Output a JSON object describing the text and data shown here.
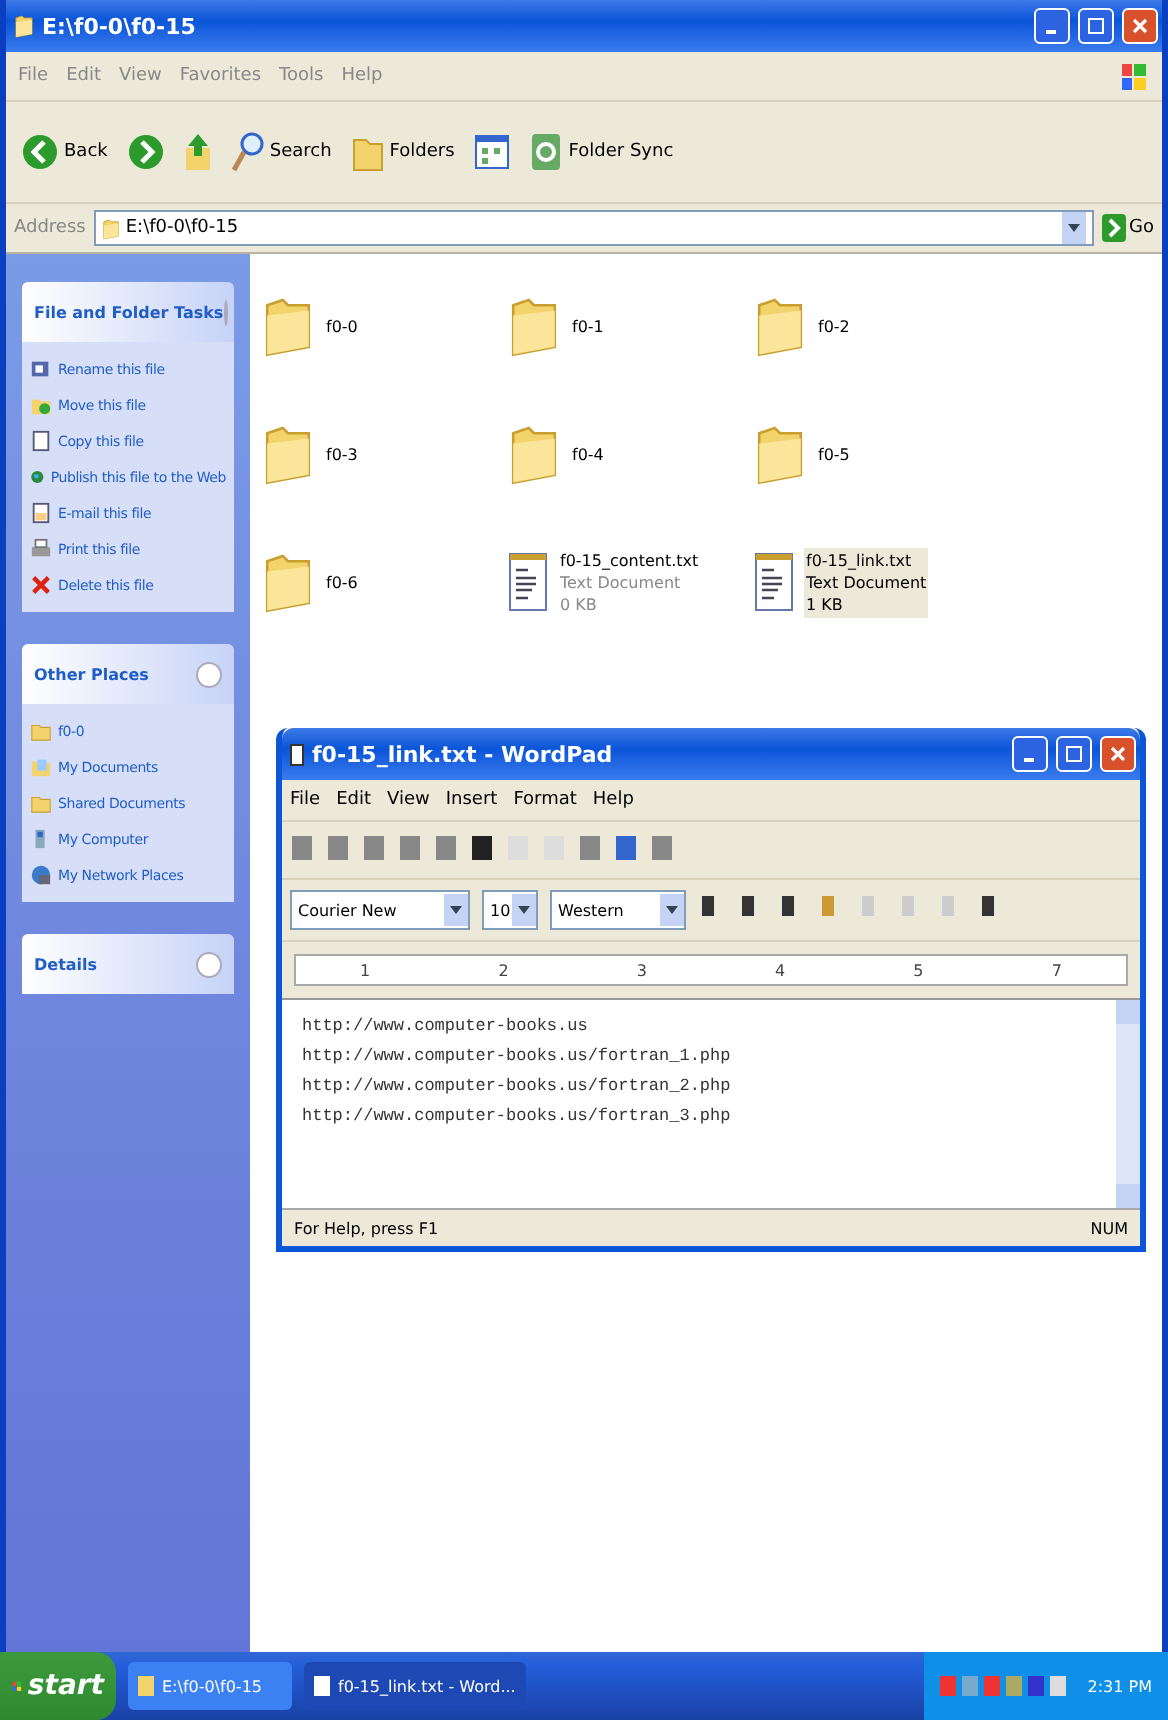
{
  "explorer": {
    "title": "E:\\f0-0\\f0-15",
    "menu": [
      "File",
      "Edit",
      "View",
      "Favorites",
      "Tools",
      "Help"
    ],
    "toolbar": [
      {
        "kind": "back",
        "label": "Back"
      },
      {
        "kind": "forward"
      },
      {
        "kind": "up"
      },
      {
        "kind": "search",
        "label": "Search"
      },
      {
        "kind": "folders",
        "label": "Folders"
      },
      {
        "kind": "views"
      },
      {
        "kind": "sync",
        "label": "Folder Sync"
      }
    ],
    "address": {
      "label": "Address",
      "value": "E:\\f0-0\\f0-15",
      "go": "Go"
    },
    "panels": [
      {
        "title": "File and Folder Tasks",
        "expanded": true,
        "items": [
          {
            "label": "Rename this file"
          },
          {
            "label": "Move this file"
          },
          {
            "label": "Copy this file"
          },
          {
            "label": "Publish this file to the Web"
          },
          {
            "label": "E-mail this file"
          },
          {
            "label": "Print this file"
          },
          {
            "label": "Delete this file"
          }
        ]
      },
      {
        "title": "Other Places",
        "expanded": true,
        "items": [
          {
            "label": "f0-0"
          },
          {
            "label": "My Documents"
          },
          {
            "label": "Shared Documents"
          },
          {
            "label": "My Computer"
          },
          {
            "label": "My Network Places"
          }
        ]
      },
      {
        "title": "Details",
        "expanded": false
      }
    ],
    "files": [
      {
        "kind": "folder",
        "name": "f0-0",
        "selected": false
      },
      {
        "kind": "folder",
        "name": "f0-1",
        "selected": false
      },
      {
        "kind": "folder",
        "name": "f0-2",
        "selected": false
      },
      {
        "kind": "folder",
        "name": "f0-3",
        "selected": false
      },
      {
        "kind": "folder",
        "name": "f0-4",
        "selected": false
      },
      {
        "kind": "folder",
        "name": "f0-5",
        "selected": false
      },
      {
        "kind": "folder",
        "name": "f0-6",
        "selected": false
      },
      {
        "kind": "text",
        "name": "f0-15_content.txt",
        "type": "Text Document",
        "size": "0 KB",
        "selected": false
      },
      {
        "kind": "text",
        "name": "f0-15_link.txt",
        "type": "Text Document",
        "size": "1 KB",
        "selected": true
      }
    ]
  },
  "wordpad": {
    "title": "f0-15_link.txt - WordPad",
    "menu": [
      "File",
      "Edit",
      "View",
      "Insert",
      "Format",
      "Help"
    ],
    "font": "Courier New",
    "size": "10",
    "script": "Western",
    "ruler": [
      "1",
      "2",
      "3",
      "4",
      "5",
      "7"
    ],
    "lines": [
      "http://www.computer-books.us",
      "http://www.computer-books.us/fortran_1.php",
      "http://www.computer-books.us/fortran_2.php",
      "http://www.computer-books.us/fortran_3.php"
    ],
    "status": "For Help, press F1",
    "num": "NUM"
  },
  "taskbar": {
    "start": "start",
    "tasks": [
      {
        "label": "E:\\f0-0\\f0-15",
        "selected": false
      },
      {
        "label": "f0-15_link.txt - Word...",
        "selected": true
      }
    ],
    "time": "2:31 PM"
  }
}
